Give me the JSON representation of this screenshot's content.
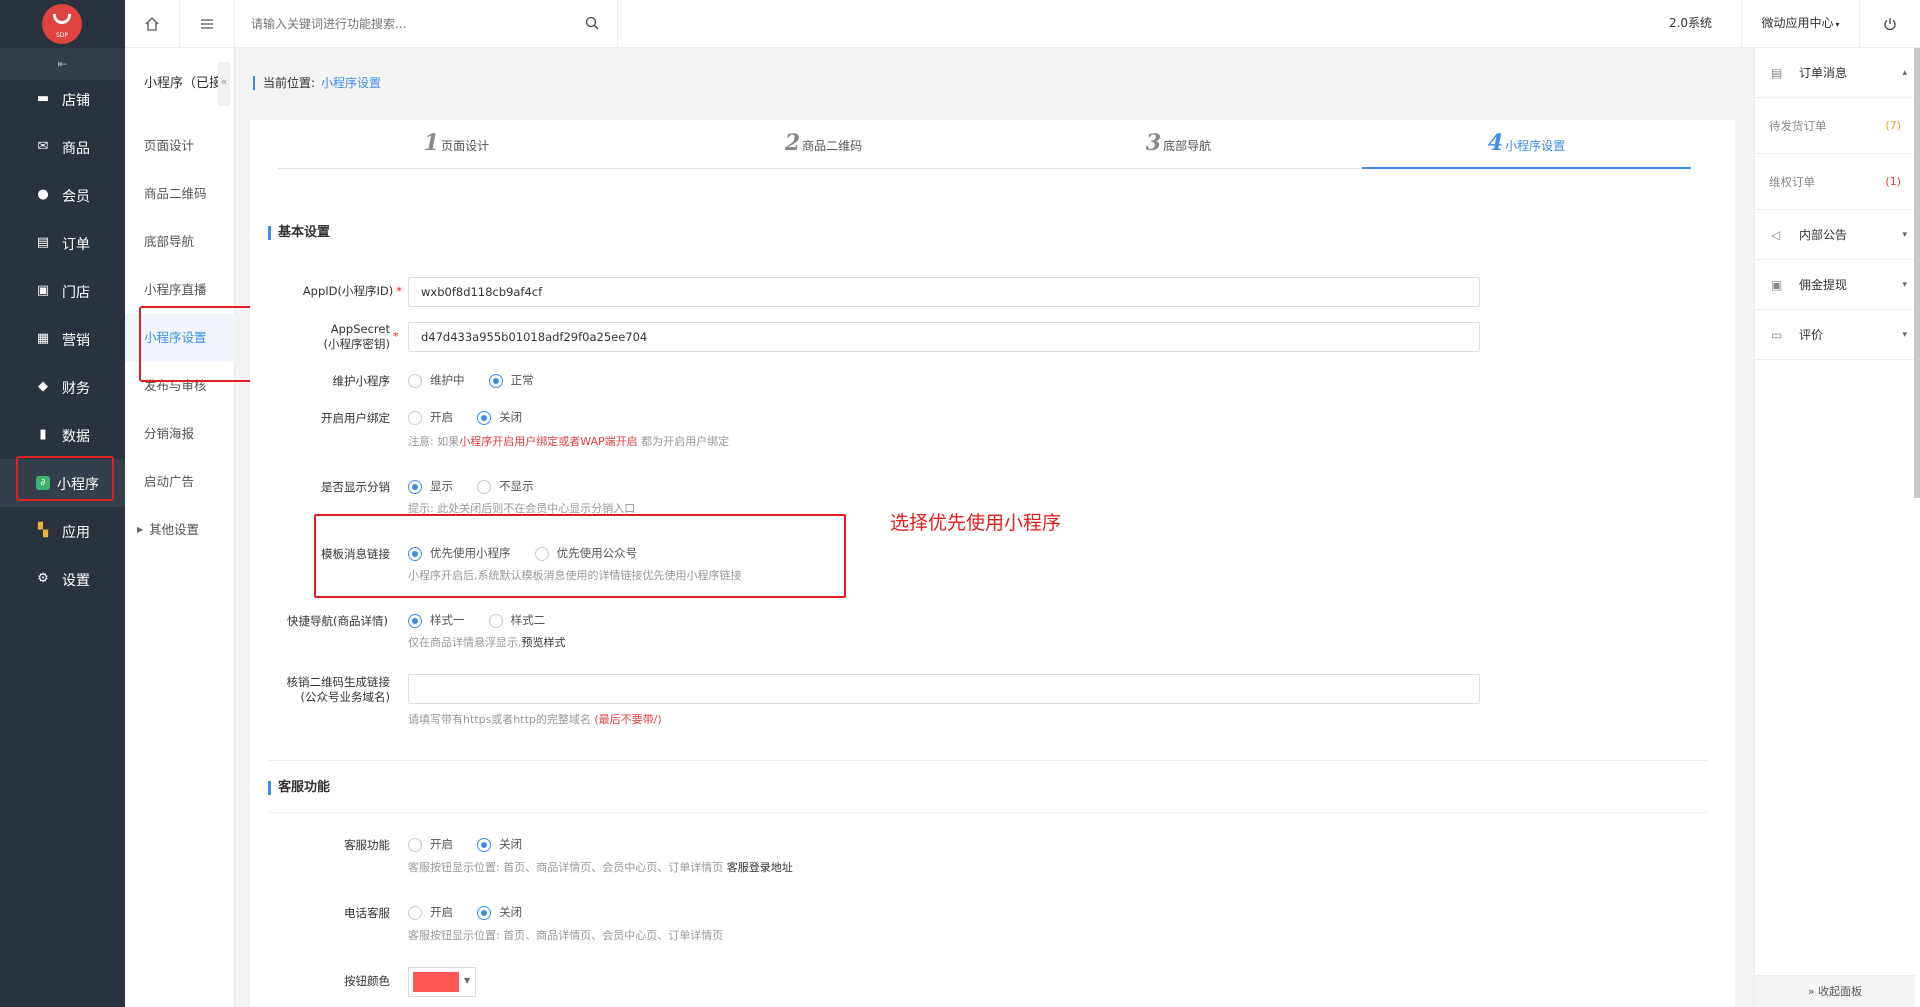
{
  "logo": {
    "text": "SDP"
  },
  "nav": {
    "collapse_glyph": "⇤",
    "items": [
      {
        "label": "店铺",
        "icon": "store-icon"
      },
      {
        "label": "商品",
        "icon": "goods-icon"
      },
      {
        "label": "会员",
        "icon": "member-icon"
      },
      {
        "label": "订单",
        "icon": "order-icon"
      },
      {
        "label": "门店",
        "icon": "shop-icon"
      },
      {
        "label": "营销",
        "icon": "gift-icon"
      },
      {
        "label": "财务",
        "icon": "money-bag-icon"
      },
      {
        "label": "数据",
        "icon": "chart-icon"
      },
      {
        "label": "小程序",
        "icon": "mini-program-icon"
      },
      {
        "label": "应用",
        "icon": "apps-icon"
      },
      {
        "label": "设置",
        "icon": "gear-icon"
      }
    ]
  },
  "subnav": {
    "title": "小程序（已接",
    "items": [
      "页面设计",
      "商品二维码",
      "底部导航",
      "小程序直播",
      "小程序设置",
      "发布与审核",
      "分销海报",
      "启动广告",
      "其他设置"
    ]
  },
  "header": {
    "search_placeholder": "请输入关键词进行功能搜索...",
    "system": "2.0系统",
    "app_center": "微动应用中心"
  },
  "breadcrumb": {
    "prefix": "当前位置:",
    "current": "小程序设置"
  },
  "steps": [
    {
      "num": "1",
      "label": "页面设计"
    },
    {
      "num": "2",
      "label": "商品二维码"
    },
    {
      "num": "3",
      "label": "底部导航"
    },
    {
      "num": "4",
      "label": "小程序设置"
    }
  ],
  "basic": {
    "heading": "基本设置",
    "appid_label": "AppID(小程序ID)",
    "appid_value": "wxb0f8d118cb9af4cf",
    "secret_label1": "AppSecret",
    "secret_label2": "(小程序密钥)",
    "secret_value": "d47d433a955b01018adf29f0a25ee704",
    "maintain_label": "维护小程序",
    "maintain_opts": [
      "维护中",
      "正常"
    ],
    "bind_label": "开启用户绑定",
    "bind_opts": [
      "开启",
      "关闭"
    ],
    "bind_hint_pre": "注意: 如果",
    "bind_hint_red": "小程序开启用户绑定或者WAP端开启",
    "bind_hint_post": "都为开启用户绑定",
    "dist_label": "是否显示分销",
    "dist_opts": [
      "显示",
      "不显示"
    ],
    "dist_hint": "提示: 此处关闭后则不在会员中心显示分销入口",
    "tpl_label": "模板消息链接",
    "tpl_opts": [
      "优先使用小程序",
      "优先使用公众号"
    ],
    "tpl_hint": "小程序开启后,系统默认模板消息使用的详情链接优先使用小程序链接",
    "quick_label": "快捷导航(商品详情)",
    "quick_opts": [
      "样式一",
      "样式二"
    ],
    "quick_hint_pre": "仅在商品详情悬浮显示,",
    "quick_hint_link": "预览样式",
    "qr_label1": "核销二维码生成链接",
    "qr_label2": "(公众号业务域名)",
    "qr_value": "",
    "qr_hint_pre": "请填写带有https或者http的完整域名",
    "qr_hint_red": "(最后不要带/)"
  },
  "annotation": "选择优先使用小程序",
  "service": {
    "heading": "客服功能",
    "cs_label": "客服功能",
    "cs_opts": [
      "开启",
      "关闭"
    ],
    "cs_hint_pre": "客服按钮显示位置: 首页、商品详情页、会员中心页、订单详情页",
    "cs_hint_link": "客服登录地址",
    "phone_label": "电话客服",
    "phone_opts": [
      "开启",
      "关闭"
    ],
    "phone_hint": "客服按钮显示位置: 首页、商品详情页、会员中心页、订单详情页",
    "color_label": "按钮颜色",
    "color_value": "#ff5555"
  },
  "rpanel": {
    "orders_msg": "订单消息",
    "pending": "待发货订单",
    "pending_count": "(7)",
    "rights": "维权订单",
    "rights_count": "(1)",
    "notice": "内部公告",
    "commission": "佣金提现",
    "review": "评价",
    "collapse": "» 收起面板"
  },
  "colors": {
    "accent": "#3d8ee8",
    "danger": "#e02020",
    "nav_bg": "#28333e",
    "pending": "#f0a020",
    "rights": "#e04040"
  }
}
